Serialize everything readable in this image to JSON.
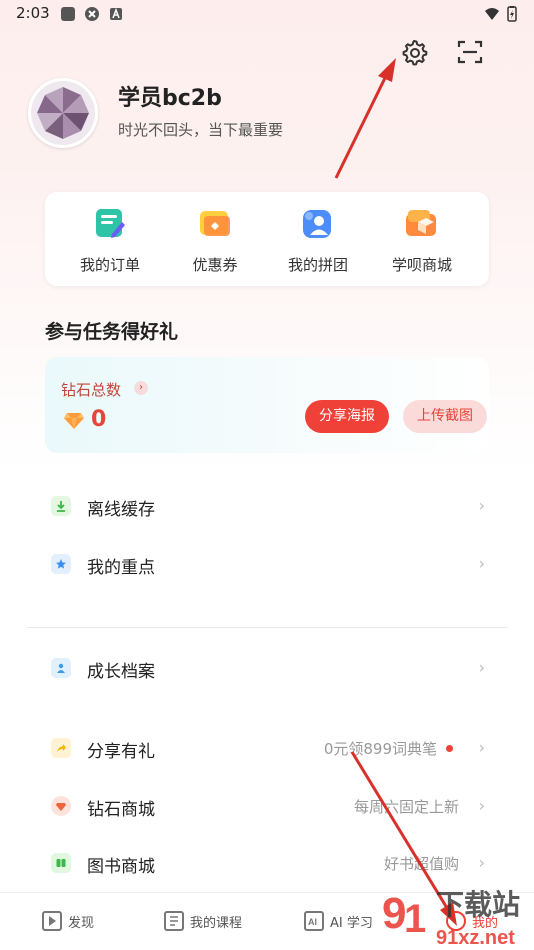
{
  "status_bar": {
    "time": "2:03"
  },
  "profile": {
    "username": "学员bc2b",
    "motto": "时光不回头，当下最重要"
  },
  "quick_actions": [
    {
      "label": "我的订单",
      "icon": "order-icon"
    },
    {
      "label": "优惠券",
      "icon": "coupon-icon"
    },
    {
      "label": "我的拼团",
      "icon": "group-buy-icon"
    },
    {
      "label": "学呗商城",
      "icon": "mall-icon"
    }
  ],
  "tasks": {
    "title": "参与任务得好礼",
    "diamond_total_label": "钻石总数",
    "diamond_count": "0",
    "share_poster": "分享海报",
    "upload_screenshot": "上传截图"
  },
  "menu": {
    "offline_cache": "离线缓存",
    "my_highlights": "我的重点",
    "growth_record": "成长档案",
    "share_gift": {
      "label": "分享有礼",
      "sub": "0元领899词典笔"
    },
    "diamond_mall": {
      "label": "钻石商城",
      "sub": "每周六固定上新"
    },
    "book_mall": {
      "label": "图书商城",
      "sub": "好书超值购"
    }
  },
  "bottom_nav": {
    "discover": "发现",
    "my_courses": "我的课程",
    "ai_study": "AI 学习",
    "mine": "我的"
  },
  "watermark": {
    "brand": "下载站",
    "domain": "91xz.net"
  },
  "colors": {
    "accent": "#ef4138",
    "annotation": "#d8312a"
  }
}
